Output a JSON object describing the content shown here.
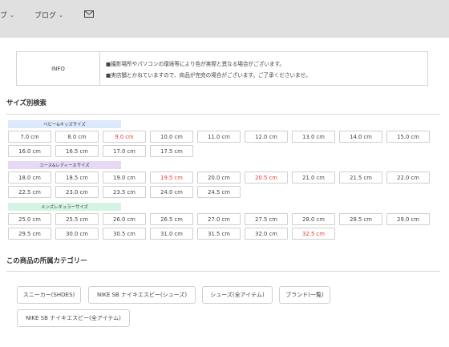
{
  "nav": {
    "items": [
      {
        "label": "ブ"
      },
      {
        "label": "ブログ"
      }
    ],
    "chevron": "⌄"
  },
  "info": {
    "label": "INFO",
    "lines": [
      "■撮影場所やパソコンの環境等により色が実際と異なる場合がございます。",
      "■実店舗とかねていますので、商品が完売の場合がございます。ご了承くださいませ。"
    ]
  },
  "size_search": {
    "title": "サイズ別検索",
    "groups": [
      {
        "label": "ベビー&キッズサイズ",
        "color": "#dbe9fb",
        "rows": [
          [
            {
              "t": "7.0 cm"
            },
            {
              "t": "8.0 cm"
            },
            {
              "t": "9.0 cm",
              "red": true
            },
            {
              "t": "10.0 cm"
            },
            {
              "t": "11.0 cm"
            },
            {
              "t": "12.0 cm"
            },
            {
              "t": "13.0 cm"
            },
            {
              "t": "14.0 cm"
            },
            {
              "t": "15.0 cm"
            }
          ],
          [
            {
              "t": "16.0 cm"
            },
            {
              "t": "16.5 cm"
            },
            {
              "t": "17.0 cm"
            },
            {
              "t": "17.5 cm"
            }
          ]
        ]
      },
      {
        "label": "ユース&レディースサイズ",
        "color": "#e7d9f6",
        "rows": [
          [
            {
              "t": "18.0 cm"
            },
            {
              "t": "18.5 cm"
            },
            {
              "t": "19.0 cm"
            },
            {
              "t": "19.5 cm",
              "red": true
            },
            {
              "t": "20.0 cm"
            },
            {
              "t": "20.5 cm",
              "red": true
            },
            {
              "t": "21.0 cm"
            },
            {
              "t": "21.5 cm"
            },
            {
              "t": "22.0 cm"
            }
          ],
          [
            {
              "t": "22.5 cm"
            },
            {
              "t": "23.0 cm"
            },
            {
              "t": "23.5 cm"
            },
            {
              "t": "24.0 cm"
            },
            {
              "t": "24.5 cm"
            }
          ]
        ]
      },
      {
        "label": "メンズレギュラーサイズ",
        "color": "#d5f4e3",
        "rows": [
          [
            {
              "t": "25.0 cm"
            },
            {
              "t": "25.5 cm"
            },
            {
              "t": "26.0 cm"
            },
            {
              "t": "26.5 cm"
            },
            {
              "t": "27.0 cm"
            },
            {
              "t": "27.5 cm"
            },
            {
              "t": "28.0 cm"
            },
            {
              "t": "28.5 cm"
            },
            {
              "t": "29.0 cm"
            }
          ],
          [
            {
              "t": "29.5 cm"
            },
            {
              "t": "30.0 cm"
            },
            {
              "t": "30.5 cm"
            },
            {
              "t": "31.0 cm"
            },
            {
              "t": "31.5 cm"
            },
            {
              "t": "32.0 cm"
            },
            {
              "t": "32.5 cm",
              "red": true
            }
          ]
        ]
      }
    ]
  },
  "categories": {
    "title": "この商品の所属カテゴリー",
    "tags": [
      "スニーカー(SHOES)",
      "NIKE SB ナイキエスビー(シューズ)",
      "シューズ(全アイテム)",
      "ブランド(一覧)",
      "NIKE SB ナイキエスビー(全アイテム)"
    ]
  }
}
